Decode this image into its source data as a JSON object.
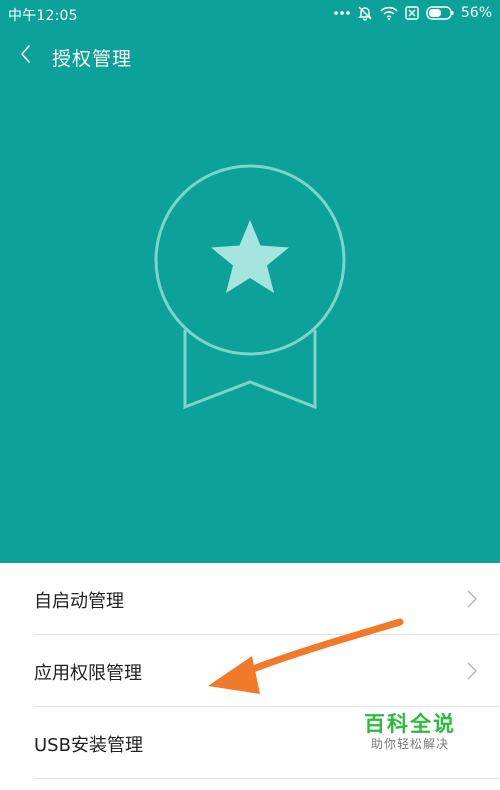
{
  "status_bar": {
    "time": "中午12:05",
    "battery_percent": "56%",
    "icons": [
      "more-dots-icon",
      "bell-muted-icon",
      "wifi-icon",
      "sim-blocked-icon",
      "battery-icon"
    ]
  },
  "header": {
    "back_icon": "back-chevron-icon",
    "title": "授权管理"
  },
  "illustration": {
    "icon": "ribbon-star-badge-icon",
    "background_color": "#0ca29a",
    "stroke_color": "#7fd3cd",
    "star_color": "#a6e4df"
  },
  "menu": {
    "items": [
      {
        "label": "自启动管理"
      },
      {
        "label": "应用权限管理"
      },
      {
        "label": "USB安装管理"
      }
    ]
  },
  "annotation": {
    "arrow_color": "#f07a2a"
  },
  "watermark": {
    "title": "百科全说",
    "subtitle": "助你轻松解决"
  }
}
